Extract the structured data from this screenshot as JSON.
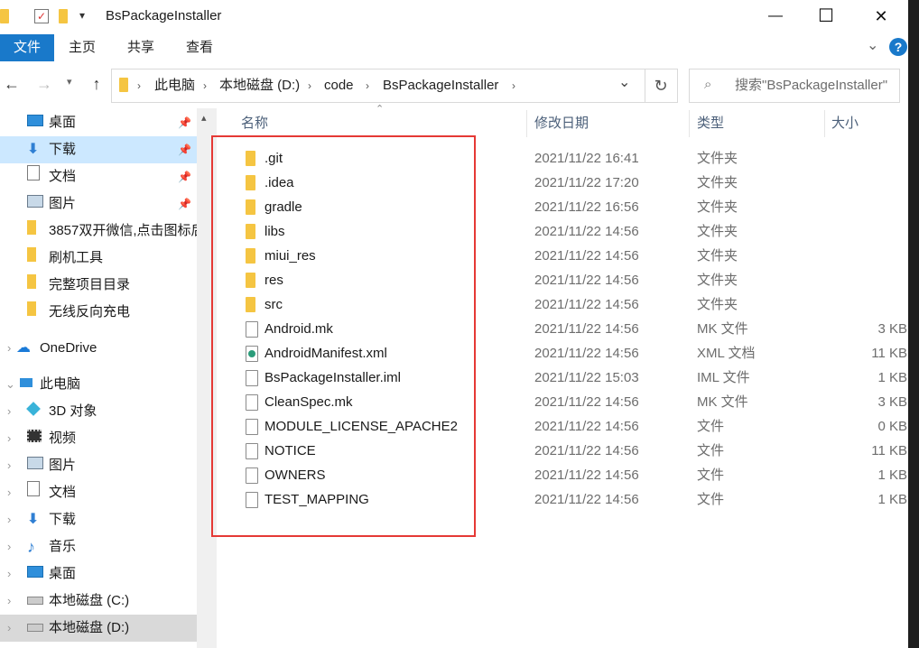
{
  "window": {
    "title": "BsPackageInstaller",
    "controls": {
      "minimize": "—",
      "maximize": "☐",
      "close": "✕"
    }
  },
  "ribbon": {
    "tabs": [
      "文件",
      "主页",
      "共享",
      "查看"
    ],
    "help": "?",
    "expand": "⌄"
  },
  "address": {
    "back": "←",
    "forward": "→",
    "up": "↑",
    "crumbs": [
      "此电脑",
      "本地磁盘 (D:)",
      "code",
      "BsPackageInstaller"
    ],
    "dropdown": "⌄",
    "refresh": "↻",
    "search_placeholder": "搜索\"BsPackageInstaller\""
  },
  "nav": {
    "quick_access": [
      {
        "label": "桌面",
        "icon": "desktop-icon",
        "pinned": true
      },
      {
        "label": "下载",
        "icon": "download-icon",
        "pinned": true
      },
      {
        "label": "文档",
        "icon": "document-icon",
        "pinned": true
      },
      {
        "label": "图片",
        "icon": "picture-icon",
        "pinned": true
      },
      {
        "label": "3857双开微信,点击图标后",
        "icon": "folder-icon",
        "pinned": false
      },
      {
        "label": "刷机工具",
        "icon": "folder-icon",
        "pinned": false
      },
      {
        "label": "完整项目目录",
        "icon": "folder-icon",
        "pinned": false
      },
      {
        "label": "无线反向充电",
        "icon": "folder-icon",
        "pinned": false
      }
    ],
    "onedrive": "OneDrive",
    "this_pc": "此电脑",
    "pc_items": [
      {
        "label": "3D 对象",
        "icon": "3d-objects-icon"
      },
      {
        "label": "视频",
        "icon": "video-icon"
      },
      {
        "label": "图片",
        "icon": "picture-icon"
      },
      {
        "label": "文档",
        "icon": "document-icon"
      },
      {
        "label": "下载",
        "icon": "download-icon"
      },
      {
        "label": "音乐",
        "icon": "music-icon"
      },
      {
        "label": "桌面",
        "icon": "desktop-icon"
      },
      {
        "label": "本地磁盘 (C:)",
        "icon": "drive-icon"
      },
      {
        "label": "本地磁盘 (D:)",
        "icon": "drive-icon"
      }
    ]
  },
  "columns": {
    "name": "名称",
    "modified": "修改日期",
    "type": "类型",
    "size": "大小"
  },
  "files": [
    {
      "name": ".git",
      "modified": "2021/11/22 16:41",
      "type": "文件夹",
      "size": "",
      "kind": "folder"
    },
    {
      "name": ".idea",
      "modified": "2021/11/22 17:20",
      "type": "文件夹",
      "size": "",
      "kind": "folder"
    },
    {
      "name": "gradle",
      "modified": "2021/11/22 16:56",
      "type": "文件夹",
      "size": "",
      "kind": "folder"
    },
    {
      "name": "libs",
      "modified": "2021/11/22 14:56",
      "type": "文件夹",
      "size": "",
      "kind": "folder"
    },
    {
      "name": "miui_res",
      "modified": "2021/11/22 14:56",
      "type": "文件夹",
      "size": "",
      "kind": "folder"
    },
    {
      "name": "res",
      "modified": "2021/11/22 14:56",
      "type": "文件夹",
      "size": "",
      "kind": "folder"
    },
    {
      "name": "src",
      "modified": "2021/11/22 14:56",
      "type": "文件夹",
      "size": "",
      "kind": "folder"
    },
    {
      "name": "Android.mk",
      "modified": "2021/11/22 14:56",
      "type": "MK 文件",
      "size": "3 KB",
      "kind": "file"
    },
    {
      "name": "AndroidManifest.xml",
      "modified": "2021/11/22 14:56",
      "type": "XML 文档",
      "size": "11 KB",
      "kind": "xml"
    },
    {
      "name": "BsPackageInstaller.iml",
      "modified": "2021/11/22 15:03",
      "type": "IML 文件",
      "size": "1 KB",
      "kind": "file"
    },
    {
      "name": "CleanSpec.mk",
      "modified": "2021/11/22 14:56",
      "type": "MK 文件",
      "size": "3 KB",
      "kind": "file"
    },
    {
      "name": "MODULE_LICENSE_APACHE2",
      "modified": "2021/11/22 14:56",
      "type": "文件",
      "size": "0 KB",
      "kind": "file"
    },
    {
      "name": "NOTICE",
      "modified": "2021/11/22 14:56",
      "type": "文件",
      "size": "11 KB",
      "kind": "file"
    },
    {
      "name": "OWNERS",
      "modified": "2021/11/22 14:56",
      "type": "文件",
      "size": "1 KB",
      "kind": "file"
    },
    {
      "name": "TEST_MAPPING",
      "modified": "2021/11/22 14:56",
      "type": "文件",
      "size": "1 KB",
      "kind": "file"
    }
  ],
  "colors": {
    "accent": "#1979ca",
    "highlight": "#e53935",
    "selected": "#cce8ff"
  }
}
